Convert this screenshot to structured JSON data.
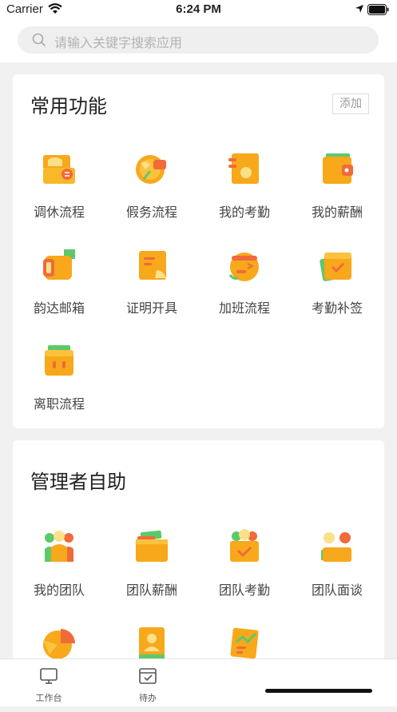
{
  "status": {
    "carrier": "Carrier",
    "time": "6:24 PM"
  },
  "search": {
    "placeholder": "请输入关键字搜索应用"
  },
  "common": {
    "title": "常用功能",
    "add_label": "添加",
    "items": [
      {
        "label": "调休流程",
        "icon": "leave-exchange-icon"
      },
      {
        "label": "假务流程",
        "icon": "vacation-icon"
      },
      {
        "label": "我的考勤",
        "icon": "attendance-icon"
      },
      {
        "label": "我的薪酬",
        "icon": "salary-wallet-icon"
      },
      {
        "label": "韵达邮箱",
        "icon": "mailbox-icon"
      },
      {
        "label": "证明开具",
        "icon": "certificate-icon"
      },
      {
        "label": "加班流程",
        "icon": "overtime-icon"
      },
      {
        "label": "考勤补签",
        "icon": "attendance-resign-icon"
      },
      {
        "label": "离职流程",
        "icon": "resignation-icon"
      }
    ]
  },
  "manager": {
    "title": "管理者自助",
    "items": [
      {
        "label": "我的团队",
        "icon": "team-icon"
      },
      {
        "label": "团队薪酬",
        "icon": "team-salary-icon"
      },
      {
        "label": "团队考勤",
        "icon": "team-attendance-icon"
      },
      {
        "label": "团队面谈",
        "icon": "team-interview-icon"
      },
      {
        "label": "",
        "icon": "pie-chart-icon"
      },
      {
        "label": "",
        "icon": "profile-card-icon"
      },
      {
        "label": "",
        "icon": "report-chart-icon"
      }
    ]
  },
  "tabs": [
    {
      "label": "工作台",
      "icon": "monitor-icon"
    },
    {
      "label": "待办",
      "icon": "todo-check-icon"
    }
  ],
  "colors": {
    "orange": "#f7a81b",
    "green": "#5cc96b",
    "red": "#f06a3a"
  }
}
